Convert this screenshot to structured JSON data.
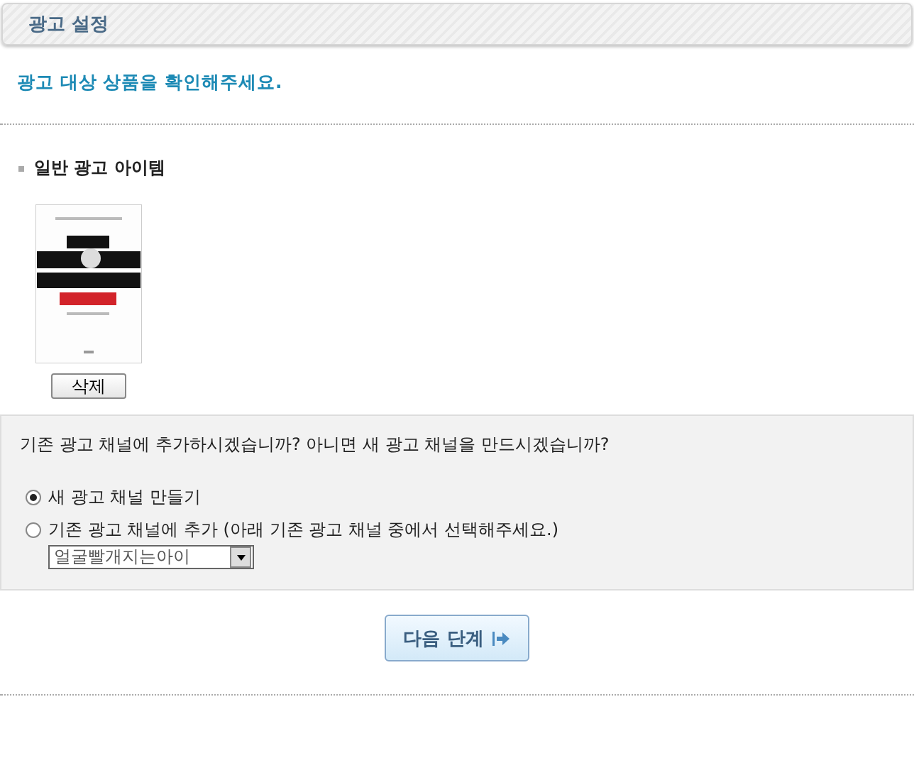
{
  "header": {
    "title": "광고 설정"
  },
  "instruction": "광고 대상 상품을 확인해주세요.",
  "section": {
    "title": "일반 광고 아이템"
  },
  "items": [
    {
      "kind": "picture",
      "delete_label": "삭제"
    }
  ],
  "channel_panel": {
    "question": "기존 광고 채널에 추가하시겠습니까? 아니면 새 광고 채널을 만드시겠습니까?",
    "options": [
      {
        "label": "새 광고 채널 만들기",
        "selected": true
      },
      {
        "label": "기존 광고 채널에 추가 (아래 기존 광고 채널 중에서 선택해주세요.)",
        "selected": false
      }
    ],
    "dropdown": {
      "value": "얼굴빨개지는아이"
    }
  },
  "next_button": "다음 단계"
}
